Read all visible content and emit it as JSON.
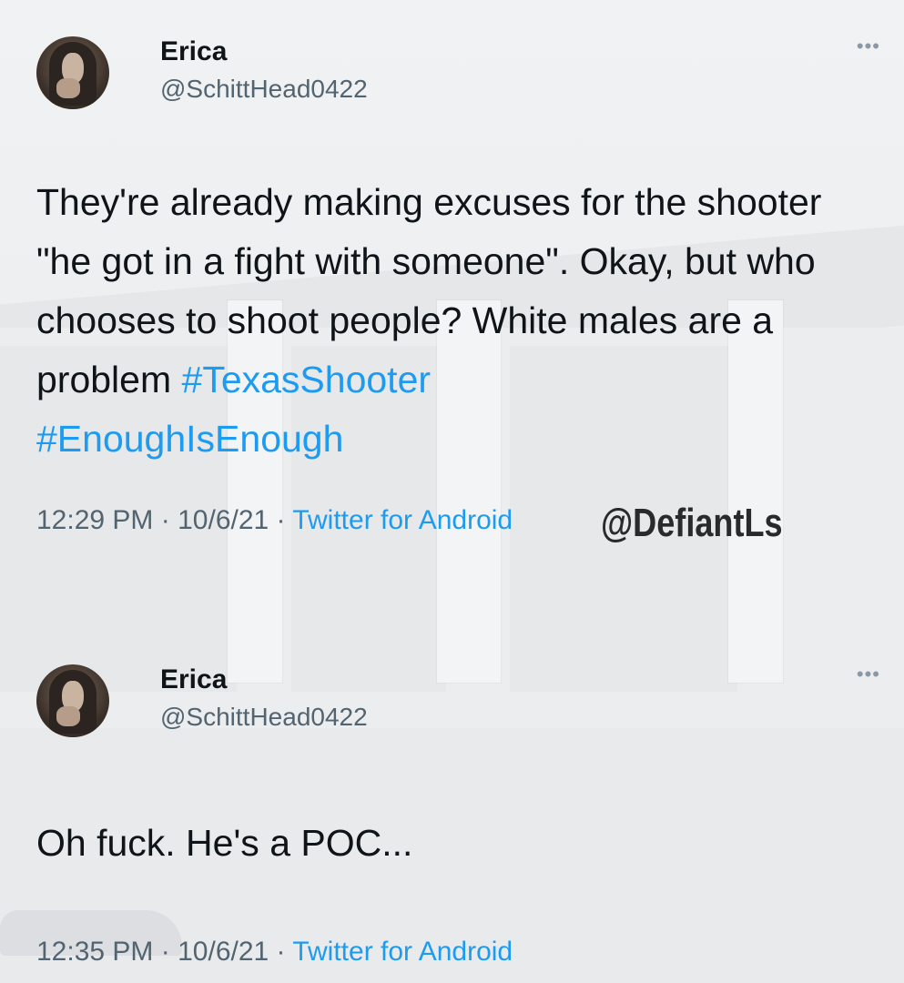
{
  "watermark": "@DefiantLs",
  "tweets": [
    {
      "name": "Erica",
      "handle": "@SchittHead0422",
      "more_icon": "more-horizontal-icon",
      "text_before": "They're already making excuses for the shooter \"he got in a fight with someone\". Okay, but who chooses to shoot people? White males are a problem ",
      "hashtags": [
        "#TexasShooter",
        "#EnoughIsEnough"
      ],
      "time": "12:29 PM",
      "date": "10/6/21",
      "source": "Twitter for Android",
      "separator": "·"
    },
    {
      "name": "Erica",
      "handle": "@SchittHead0422",
      "more_icon": "more-horizontal-icon",
      "text": "Oh fuck. He's a POC...",
      "time": "12:35 PM",
      "date": "10/6/21",
      "source": "Twitter for Android",
      "separator": "·"
    }
  ],
  "colors": {
    "text": "#0f1419",
    "secondary": "#536471",
    "link": "#1d9bf0"
  }
}
